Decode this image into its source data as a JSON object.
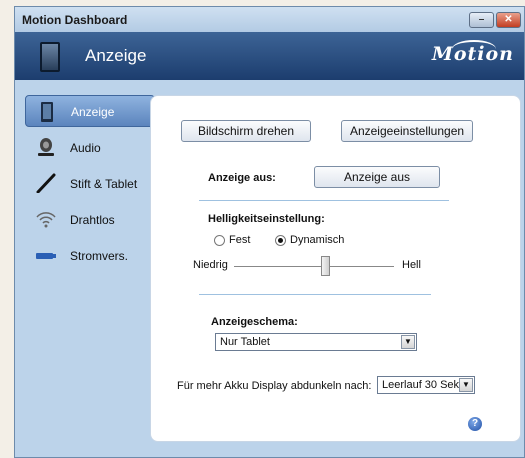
{
  "window": {
    "title": "Motion Dashboard"
  },
  "header": {
    "title": "Anzeige",
    "logo": "Motion"
  },
  "sidebar": {
    "items": [
      {
        "label": "Anzeige",
        "icon": "tablet-icon",
        "active": true
      },
      {
        "label": "Audio",
        "icon": "speaker-icon",
        "active": false
      },
      {
        "label": "Stift & Tablet",
        "icon": "pen-icon",
        "active": false
      },
      {
        "label": "Drahtlos",
        "icon": "wireless-icon",
        "active": false
      },
      {
        "label": "Stromvers.",
        "icon": "battery-icon",
        "active": false
      }
    ]
  },
  "main": {
    "rotate_button": "Bildschirm drehen",
    "display_settings_button": "Anzeigeeinstellungen",
    "display_off_label": "Anzeige aus:",
    "display_off_button": "Anzeige aus",
    "brightness_label": "Helligkeitseinstellung:",
    "radio_fixed": "Fest",
    "radio_dynamic": "Dynamisch",
    "selected_mode": "Dynamisch",
    "slider_min_label": "Niedrig",
    "slider_max_label": "Hell",
    "slider_value_fraction": 0.57,
    "scheme_label": "Anzeigeschema:",
    "scheme_value": "Nur Tablet",
    "dim_label": "Für mehr Akku Display abdunkeln nach:",
    "dim_value": "Leerlauf 30 Sek",
    "help_glyph": "?"
  },
  "colors": {
    "header": "#2a4d80",
    "accent": "#5b84bd",
    "window": "#bcd3ea"
  }
}
